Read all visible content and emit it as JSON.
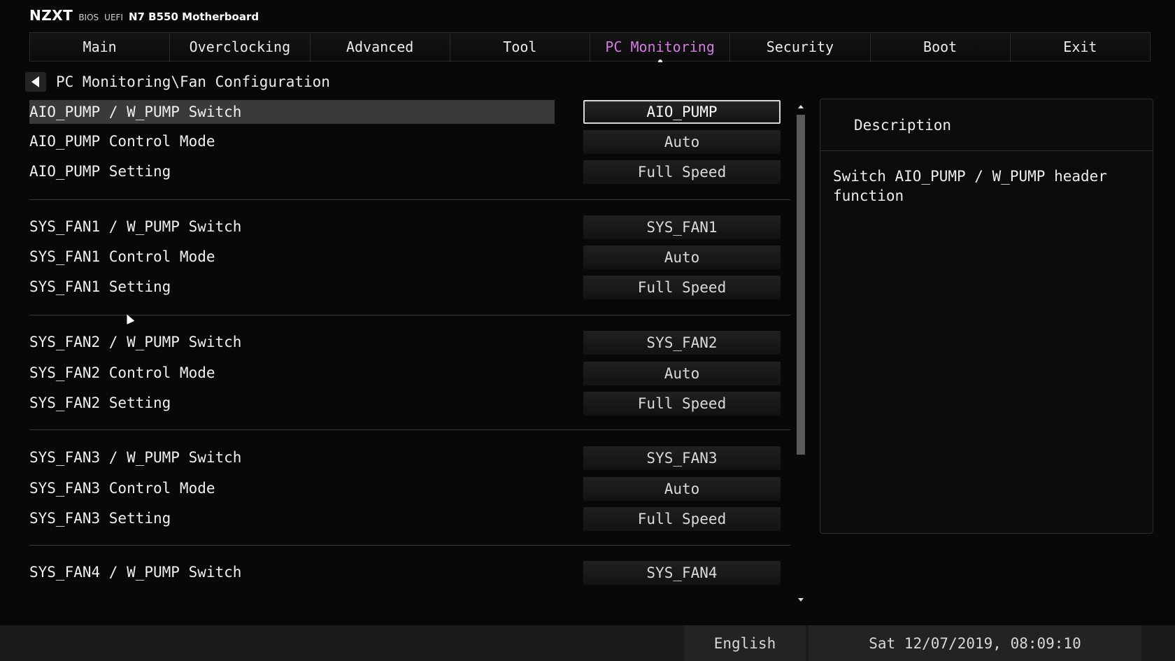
{
  "header": {
    "logo": "NZXT",
    "bios": "BIOS",
    "uefi": "UEFI",
    "board": "N7 B550 Motherboard"
  },
  "tabs": [
    {
      "label": "Main"
    },
    {
      "label": "Overclocking"
    },
    {
      "label": "Advanced"
    },
    {
      "label": "Tool"
    },
    {
      "label": "PC Monitoring",
      "active": true
    },
    {
      "label": "Security"
    },
    {
      "label": "Boot"
    },
    {
      "label": "Exit"
    }
  ],
  "breadcrumb": "PC Monitoring\\Fan Configuration",
  "settings": [
    {
      "label": "AIO_PUMP / W_PUMP Switch",
      "value": "AIO_PUMP",
      "selected": true
    },
    {
      "label": "AIO_PUMP Control Mode",
      "value": "Auto"
    },
    {
      "label": "AIO_PUMP Setting",
      "value": "Full Speed"
    },
    {
      "label": "SYS_FAN1 / W_PUMP Switch",
      "value": "SYS_FAN1"
    },
    {
      "label": "SYS_FAN1 Control Mode",
      "value": "Auto"
    },
    {
      "label": "SYS_FAN1 Setting",
      "value": "Full Speed"
    },
    {
      "label": "SYS_FAN2 / W_PUMP Switch",
      "value": "SYS_FAN2"
    },
    {
      "label": "SYS_FAN2 Control Mode",
      "value": "Auto"
    },
    {
      "label": "SYS_FAN2 Setting",
      "value": "Full Speed"
    },
    {
      "label": "SYS_FAN3 / W_PUMP Switch",
      "value": "SYS_FAN3"
    },
    {
      "label": "SYS_FAN3 Control Mode",
      "value": "Auto"
    },
    {
      "label": "SYS_FAN3 Setting",
      "value": "Full Speed"
    },
    {
      "label": "SYS_FAN4 / W_PUMP Switch",
      "value": "SYS_FAN4"
    }
  ],
  "description": {
    "title": "Description",
    "text": "Switch AIO_PUMP / W_PUMP header function"
  },
  "footer": {
    "language": "English",
    "datetime": "Sat 12/07/2019, 08:09:10"
  },
  "colors": {
    "accent": "#d57be3",
    "background": "#080808",
    "selection": "#3a3a3a"
  },
  "icons": {
    "back": "back-arrow-icon",
    "scroll_up": "scroll-up-icon",
    "scroll_down": "scroll-down-icon",
    "cursor": "mouse-cursor-icon"
  }
}
